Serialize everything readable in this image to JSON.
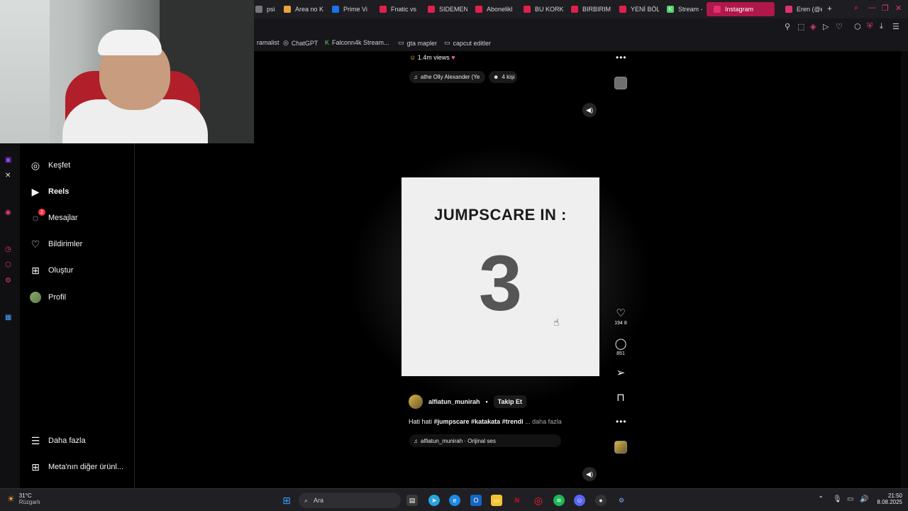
{
  "browser": {
    "tabs": [
      {
        "label": "psizi",
        "icon_color": "#777777",
        "icon": ""
      },
      {
        "label": "Area no K",
        "icon_color": "#e8a33a",
        "icon": ""
      },
      {
        "label": "Prime Vi",
        "icon_color": "#1a73e8",
        "icon": ""
      },
      {
        "label": "Fnatic vs",
        "icon_color": "#e0204d",
        "icon": ""
      },
      {
        "label": "SIDEMEN",
        "icon_color": "#e0204d",
        "icon": ""
      },
      {
        "label": "Abonelikl",
        "icon_color": "#e0204d",
        "icon": ""
      },
      {
        "label": "BU KORK",
        "icon_color": "#e0204d",
        "icon": ""
      },
      {
        "label": "BIRBIRIM",
        "icon_color": "#e0204d",
        "icon": ""
      },
      {
        "label": "YENİ BÖL",
        "icon_color": "#e0204d",
        "icon": ""
      },
      {
        "label": "Stream -",
        "icon_color": "#52d36b",
        "icon": "K"
      },
      {
        "label": "Instagram",
        "icon_color": "#e1306c",
        "icon": "",
        "active": true
      },
      {
        "label": "Eren (@er",
        "icon_color": "#e1306c",
        "icon": ""
      }
    ],
    "new_tab": "+",
    "bookmarks": [
      {
        "label": "ramalist",
        "icon": ""
      },
      {
        "label": "ChatGPT",
        "icon": "◎"
      },
      {
        "label": "Falconn4k Stream...",
        "icon": "K"
      },
      {
        "label": "gta mapler",
        "icon": "▭"
      },
      {
        "label": "capcut editler",
        "icon": "▭"
      }
    ]
  },
  "sidebar": {
    "items": [
      {
        "label": "Keşfet",
        "icon": "explore-icon",
        "glyph": "◎"
      },
      {
        "label": "Reels",
        "icon": "reels-icon",
        "glyph": "▶",
        "bold": true
      },
      {
        "label": "Mesajlar",
        "icon": "messenger-icon",
        "glyph": "◌",
        "badge": "2"
      },
      {
        "label": "Bildirimler",
        "icon": "heart-icon",
        "glyph": "♡"
      },
      {
        "label": "Oluştur",
        "icon": "create-icon",
        "glyph": "⊞"
      },
      {
        "label": "Profil",
        "icon": "avatar",
        "glyph": ""
      }
    ],
    "more_label": "Daha fazla",
    "meta_label": "Meta'nın diğer ürünl..."
  },
  "previous_reel": {
    "views": "1.4m views",
    "audio": "athe  Olly Alexander (Ye",
    "people": "4 kişi"
  },
  "reel": {
    "title": "JUMPSCARE IN :",
    "count": "3",
    "likes": "194 8",
    "comments": "851",
    "author": "alfiatun_munirah",
    "follow": "Takip Et",
    "caption_prefix": "Hati hati ",
    "hashtags": "#jumpscare #katakata #trendi",
    "more": "... daha fazla",
    "audio": "alfiatun_munirah · Orijinal ses"
  },
  "taskbar": {
    "temp": "31°C",
    "weather": "Rüzgarlı",
    "search": "Ara",
    "time": "21:50",
    "date": "8.08.2025"
  }
}
